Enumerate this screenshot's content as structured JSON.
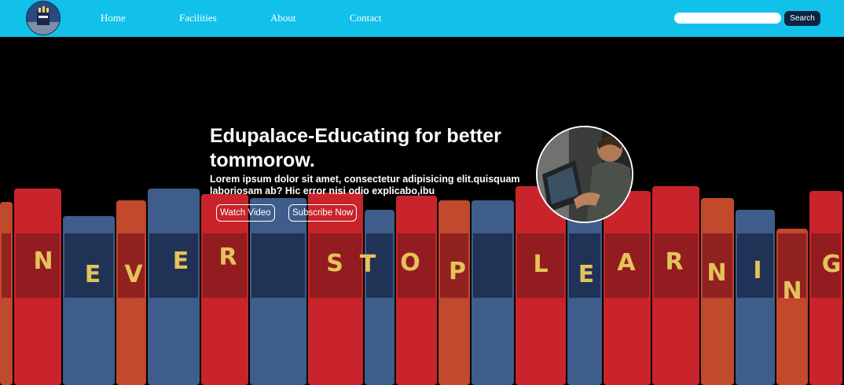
{
  "nav": {
    "links": [
      "Home",
      "Facilities",
      "About",
      "Contact"
    ],
    "search_placeholder": "",
    "search_button": "Search"
  },
  "hero": {
    "title": "Edupalace-Educating for better tommorow.",
    "text": "Lorem ipsum dolor sit amet, consectetur adipisicing elit.quisquam laboriosam ab? Hic error nisi odio explicabo,ibu",
    "buttons": [
      "Watch Video",
      "Subscribe Now"
    ],
    "banner_letters": [
      "N",
      "E",
      "V",
      "E",
      "R",
      "S",
      "T",
      "O",
      "P",
      "L",
      "E",
      "A",
      "R",
      "N",
      "I",
      "N",
      "G"
    ]
  },
  "colors": {
    "navbar": "#12c1ea",
    "search_button": "#0a2442",
    "background": "#000000",
    "book_red": "#c9242b",
    "book_blue": "#3f5d8a",
    "book_orange": "#c1492c",
    "letter_gold": "#e4c35a"
  },
  "icons": {
    "logo": "school-logo-icon",
    "avatar": "person-at-laptop-image"
  }
}
